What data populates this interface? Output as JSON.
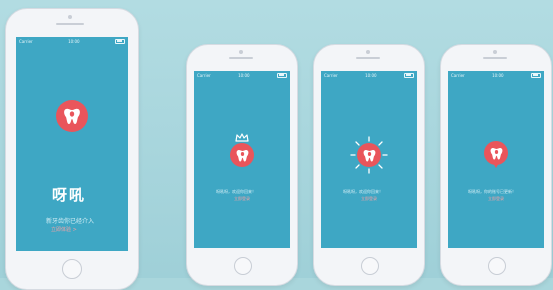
{
  "phones": [
    {
      "status": {
        "carrier": "Carrier",
        "time": "10:00"
      },
      "app_title": "呀吼",
      "subtitle": "新牙齿你已经介入",
      "link": "立即体验 >"
    },
    {
      "status": {
        "carrier": "Carrier",
        "time": "10:00"
      },
      "line1": "呀吼呀，欢迎你回来！",
      "line2": "立即登录"
    },
    {
      "status": {
        "carrier": "Carrier",
        "time": "10:00"
      },
      "line1": "呀吼呀，欢迎你回来！",
      "line2": "立即登录"
    },
    {
      "status": {
        "carrier": "Carrier",
        "time": "10:00"
      },
      "line1": "呀吼呀，你的账号已更新！",
      "line2": "立即登录"
    }
  ],
  "icons": {
    "logo": "tooth-icon",
    "crown": "crown-icon",
    "sun": "sunburst-icon",
    "pin": "map-pin-icon"
  },
  "colors": {
    "background": "#a9d6dc",
    "screen": "#3ea7c4",
    "accent": "#e9555b"
  }
}
